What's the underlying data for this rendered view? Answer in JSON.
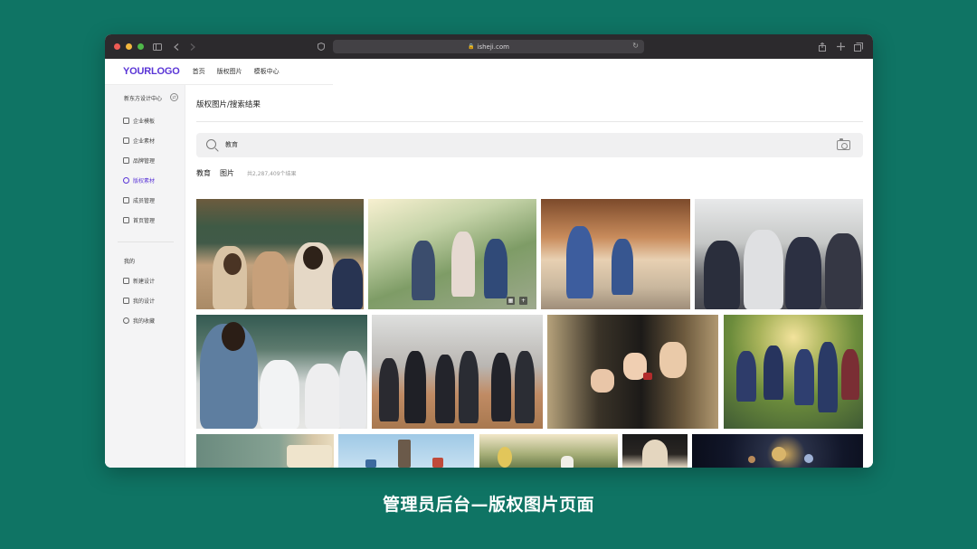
{
  "browser": {
    "url": "isheji.com"
  },
  "header": {
    "logo": "YOURLOGO",
    "nav": [
      "首页",
      "版权图片",
      "模板中心"
    ]
  },
  "sidebar": {
    "header": "新东方设计中心",
    "items": [
      {
        "label": "企业模板",
        "icon": "template-icon"
      },
      {
        "label": "企业素材",
        "icon": "image-icon"
      },
      {
        "label": "品牌管理",
        "icon": "brand-icon"
      },
      {
        "label": "版权素材",
        "icon": "copyright-icon",
        "active": true
      },
      {
        "label": "成员管理",
        "icon": "members-icon"
      },
      {
        "label": "首页管理",
        "icon": "home-icon"
      }
    ],
    "section_title": "我的",
    "my_items": [
      {
        "label": "新建设计",
        "icon": "plus-icon"
      },
      {
        "label": "我的设计",
        "icon": "design-icon"
      },
      {
        "label": "我的收藏",
        "icon": "star-icon"
      }
    ]
  },
  "main": {
    "breadcrumb": "版权图片/搜索结果",
    "search": {
      "value": "教育"
    },
    "tags": [
      "教育",
      "图片"
    ],
    "result_count": "共2,287,409个结果"
  },
  "caption": "管理员后台—版权图片页面",
  "colors": {
    "background": "#0f7464",
    "accent": "#5a35d6"
  }
}
